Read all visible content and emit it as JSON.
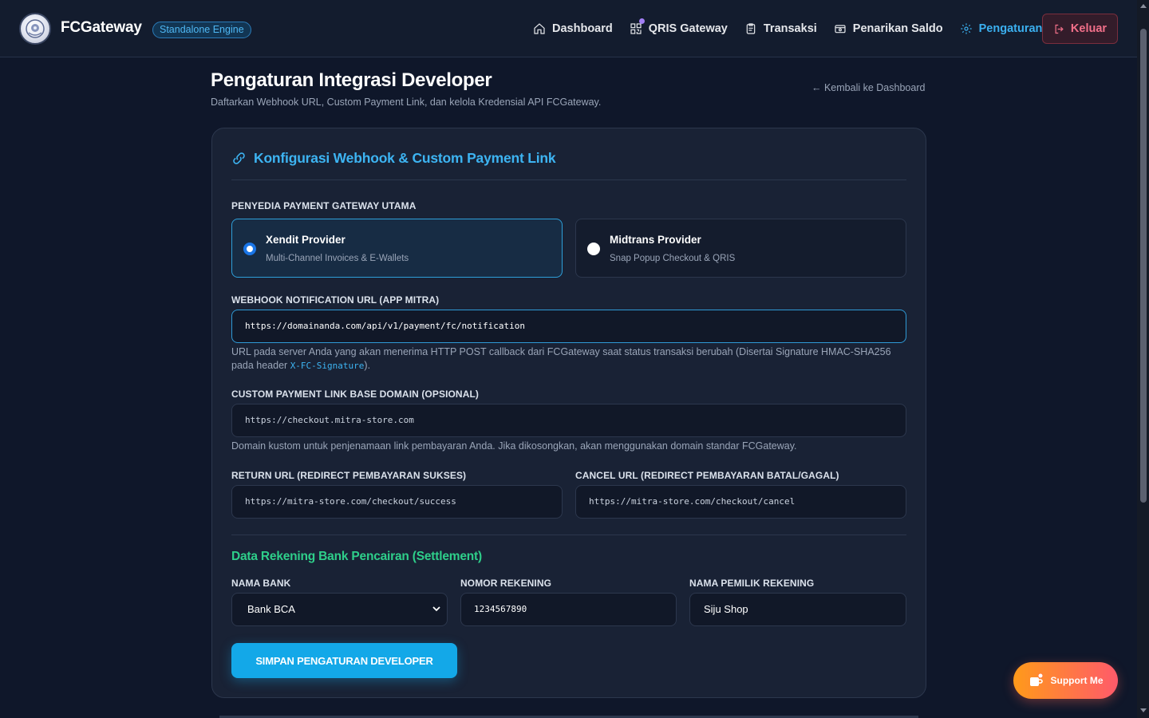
{
  "navbar": {
    "brand": "FCGateway",
    "badge": "Standalone Engine",
    "items": [
      {
        "label": "Dashboard",
        "icon": "home-icon"
      },
      {
        "label": "QRIS Gateway",
        "icon": "qr-code-icon"
      },
      {
        "label": "Transaksi",
        "icon": "clipboard-icon"
      },
      {
        "label": "Penarikan Saldo",
        "icon": "wallet-icon"
      },
      {
        "label": "Pengaturan",
        "icon": "gear-icon",
        "active": true
      }
    ],
    "logout": "Keluar"
  },
  "header": {
    "title": "Pengaturan Integrasi Developer",
    "subtitle": "Daftarkan Webhook URL, Custom Payment Link, dan kelola Kredensial API FCGateway.",
    "back": "← Kembali ke Dashboard"
  },
  "card": {
    "title": "Konfigurasi Webhook & Custom Payment Link",
    "provider_label": "PENYEDIA PAYMENT GATEWAY UTAMA",
    "providers": [
      {
        "name": "Xendit Provider",
        "desc": "Multi-Channel Invoices & E-Wallets",
        "selected": true
      },
      {
        "name": "Midtrans Provider",
        "desc": "Snap Popup Checkout & QRIS",
        "selected": false
      }
    ],
    "webhook": {
      "label": "WEBHOOK NOTIFICATION URL (APP MITRA)",
      "value": "https://domainanda.com/api/v1/payment/fc/notification",
      "help_a": "URL pada server Anda yang akan menerima HTTP POST callback dari FCGateway saat status transaksi berubah (Disertai Signature HMAC-SHA256 pada header ",
      "help_code": "X-FC-Signature",
      "help_b": ")."
    },
    "custom_domain": {
      "label": "CUSTOM PAYMENT LINK BASE DOMAIN (OPSIONAL)",
      "placeholder": "https://checkout.mitra-store.com",
      "help": "Domain kustom untuk penjenamaan link pembayaran Anda. Jika dikosongkan, akan menggunakan domain standar FCGateway."
    },
    "return_url": {
      "label": "RETURN URL (REDIRECT PEMBAYARAN SUKSES)",
      "placeholder": "https://mitra-store.com/checkout/success"
    },
    "cancel_url": {
      "label": "CANCEL URL (REDIRECT PEMBAYARAN BATAL/GAGAL)",
      "placeholder": "https://mitra-store.com/checkout/cancel"
    },
    "settlement": {
      "title": "Data Rekening Bank Pencairan (Settlement)",
      "bank_label": "NAMA BANK",
      "bank_value": "Bank BCA",
      "account_label": "NOMOR REKENING",
      "account_value": "1234567890",
      "owner_label": "NAMA PEMILIK REKENING",
      "owner_value": "Siju Shop"
    },
    "submit": "SIMPAN PENGATURAN DEVELOPER"
  },
  "support": "Support Me",
  "colors": {
    "background": "#0f172a",
    "accent": "#3db4f2",
    "settlement": "#2ecf8a",
    "danger": "#f2708a"
  }
}
